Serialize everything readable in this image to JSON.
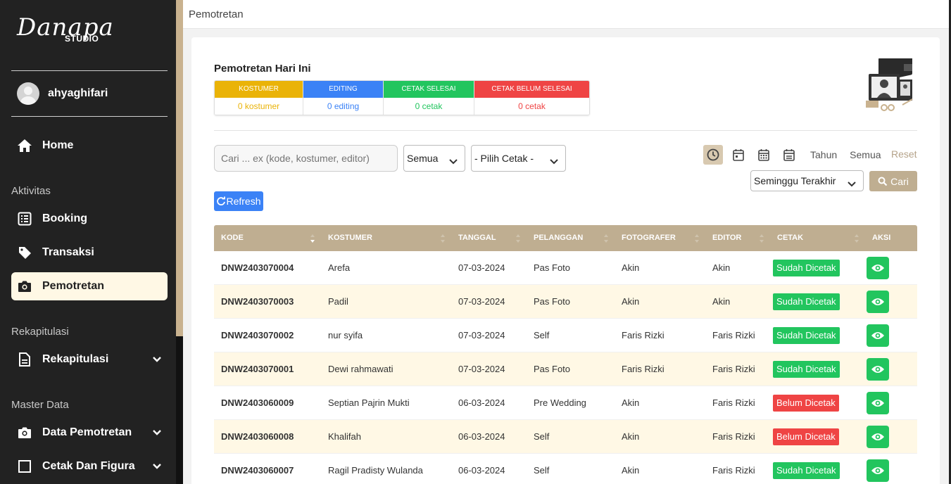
{
  "sidebar": {
    "logo_script": "Danapa",
    "logo_sub": "STUDIO",
    "user": "ahyaghifari",
    "home": "Home",
    "sections": {
      "aktivitas": "Aktivitas",
      "rekapitulasi": "Rekapitulasi",
      "master": "Master Data"
    },
    "items": {
      "booking": "Booking",
      "transaksi": "Transaksi",
      "pemotretan": "Pemotretan",
      "rekapitulasi": "Rekapitulasi",
      "data_pemotretan": "Data Pemotretan",
      "cetak_figura": "Cetak Dan Figura"
    }
  },
  "topbar": {
    "title": "Pemotretan"
  },
  "card": {
    "title": "Pemotretan Hari Ini",
    "summary": [
      {
        "label": "KOSTUMER",
        "value": "0 kostumer",
        "color": "#eab308"
      },
      {
        "label": "EDITING",
        "value": "0 editing",
        "color": "#3b82f6"
      },
      {
        "label": "CETAK SELESAI",
        "value": "0 cetak",
        "color": "#22c55e"
      },
      {
        "label": "CETAK BELUM SELESAI",
        "value": "0 cetak",
        "color": "#ef4444"
      }
    ]
  },
  "filters": {
    "search_placeholder": "Cari ... ex (kode, kostumer, editor)",
    "status_select": "Semua",
    "cetak_select": "- Pilih Cetak -",
    "tahun": "Tahun",
    "semua": "Semua",
    "reset": "Reset",
    "period_select": "Seminggu Terakhir",
    "cari": "Cari",
    "refresh": "Refresh"
  },
  "table": {
    "headers": [
      "KODE",
      "KOSTUMER",
      "TANGGAL",
      "PELANGGAN",
      "FOTOGRAFER",
      "EDITOR",
      "CETAK",
      "AKSI"
    ],
    "rows": [
      {
        "kode": "DNW2403070004",
        "kostumer": "Arefa",
        "tanggal": "07-03-2024",
        "pelanggan": "Pas Foto",
        "fotografer": "Akin",
        "editor": "Akin",
        "cetak": "Sudah Dicetak",
        "ok": true
      },
      {
        "kode": "DNW2403070003",
        "kostumer": "Padil",
        "tanggal": "07-03-2024",
        "pelanggan": "Pas Foto",
        "fotografer": "Akin",
        "editor": "Akin",
        "cetak": "Sudah Dicetak",
        "ok": true
      },
      {
        "kode": "DNW2403070002",
        "kostumer": "nur syifa",
        "tanggal": "07-03-2024",
        "pelanggan": "Self",
        "fotografer": "Faris Rizki",
        "editor": "Faris Rizki",
        "cetak": "Sudah Dicetak",
        "ok": true
      },
      {
        "kode": "DNW2403070001",
        "kostumer": "Dewi rahmawati",
        "tanggal": "07-03-2024",
        "pelanggan": "Pas Foto",
        "fotografer": "Faris Rizki",
        "editor": "Faris Rizki",
        "cetak": "Sudah Dicetak",
        "ok": true
      },
      {
        "kode": "DNW2403060009",
        "kostumer": "Septian Pajrin Mukti",
        "tanggal": "06-03-2024",
        "pelanggan": "Pre Wedding",
        "fotografer": "Akin",
        "editor": "Faris Rizki",
        "cetak": "Belum Dicetak",
        "ok": false
      },
      {
        "kode": "DNW2403060008",
        "kostumer": "Khalifah",
        "tanggal": "06-03-2024",
        "pelanggan": "Self",
        "fotografer": "Akin",
        "editor": "Faris Rizki",
        "cetak": "Belum Dicetak",
        "ok": false
      },
      {
        "kode": "DNW2403060007",
        "kostumer": "Ragil Pradisty Wulanda",
        "tanggal": "06-03-2024",
        "pelanggan": "Self",
        "fotografer": "Akin",
        "editor": "Faris Rizki",
        "cetak": "Sudah Dicetak",
        "ok": true
      }
    ]
  },
  "colors": {
    "sidebar_bg": "#222222",
    "accent": "#bfae91",
    "active_bg": "#fff8e5",
    "success": "#22c55e",
    "danger": "#ef4444",
    "primary": "#3b82f6"
  }
}
